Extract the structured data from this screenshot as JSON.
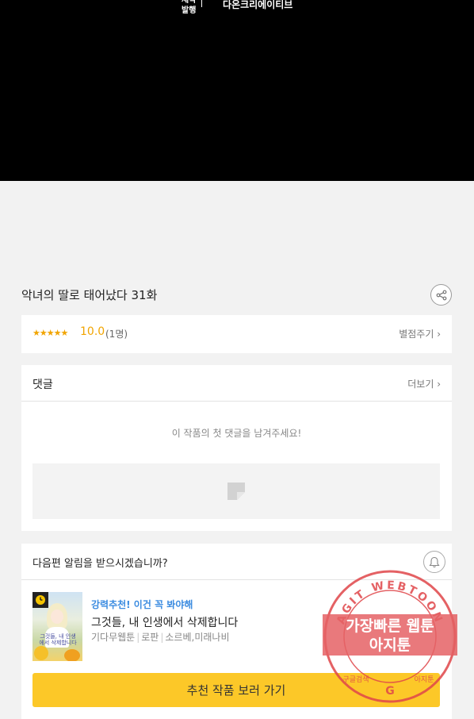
{
  "viewer": {
    "credit_line1": "제작",
    "credit_line2": "발행",
    "company": "다온크리에이티브"
  },
  "episode": {
    "title": "악녀의 딸로 태어났다 31화",
    "share_icon": "share-icon"
  },
  "rating": {
    "stars": "★★★★★",
    "score": "10.0",
    "count": "(1명)",
    "rate_link": "별점주기 ›"
  },
  "comments": {
    "title": "댓글",
    "more_link": "더보기 ›",
    "empty_text": "이 작품의 첫 댓글을 남겨주세요!"
  },
  "next_notify": {
    "title": "다음편 알림을 받으시겠습니까?",
    "bell_icon": "bell-icon"
  },
  "recommendation": {
    "label": "강력추천! 이건 꼭 봐야해",
    "title": "그것들, 내 인생에서 삭제합니다",
    "meta": [
      "기다무웹툰",
      "로판",
      "소르베,미래나비"
    ],
    "thumb_text": "그것들, 내 인생에서 삭제합니다",
    "button": "추천 작품 보러 가기"
  },
  "watermark": {
    "arc_text": "AGIT WEBTOON",
    "line1": "가장빠른 웹툰",
    "line2": "아지툰",
    "bottom_left": "구글검색",
    "bottom_right": "아지툰"
  },
  "colors": {
    "accent_star": "#f1a400",
    "button": "#fcc828",
    "link_blue": "#3a8be0",
    "watermark_red": "#e0464a"
  }
}
